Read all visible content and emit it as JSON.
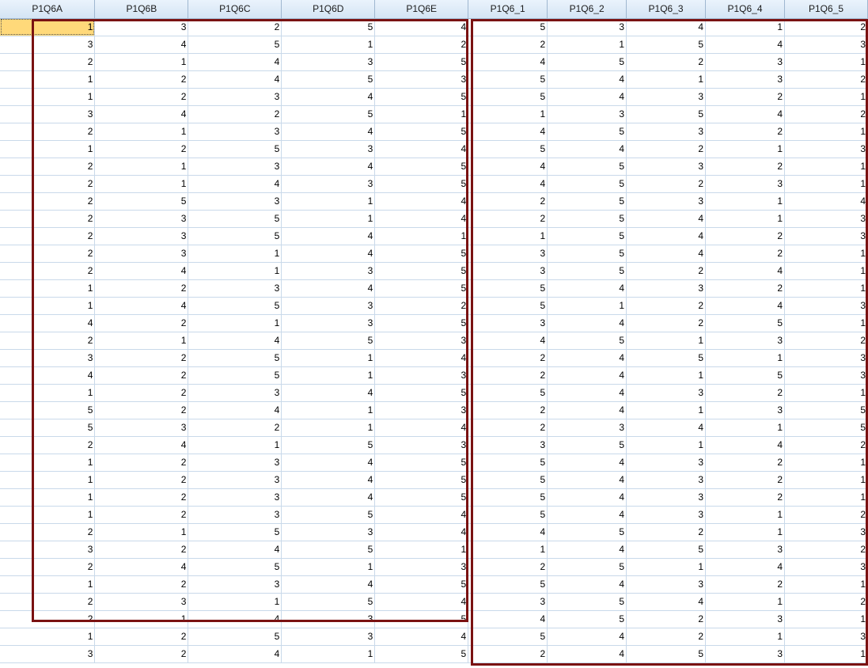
{
  "columns": [
    "P1Q6A",
    "P1Q6B",
    "P1Q6C",
    "P1Q6D",
    "P1Q6E",
    "P1Q6_1",
    "P1Q6_2",
    "P1Q6_3",
    "P1Q6_4",
    "P1Q6_5"
  ],
  "rows": [
    [
      "1",
      "3",
      "2",
      "5",
      "4",
      "5",
      "3",
      "4",
      "1",
      "2"
    ],
    [
      "3",
      "4",
      "5",
      "1",
      "2",
      "2",
      "1",
      "5",
      "4",
      "3"
    ],
    [
      "2",
      "1",
      "4",
      "3",
      "5",
      "4",
      "5",
      "2",
      "3",
      "1"
    ],
    [
      "1",
      "2",
      "4",
      "5",
      "3",
      "5",
      "4",
      "1",
      "3",
      "2"
    ],
    [
      "1",
      "2",
      "3",
      "4",
      "5",
      "5",
      "4",
      "3",
      "2",
      "1"
    ],
    [
      "3",
      "4",
      "2",
      "5",
      "1",
      "1",
      "3",
      "5",
      "4",
      "2"
    ],
    [
      "2",
      "1",
      "3",
      "4",
      "5",
      "4",
      "5",
      "3",
      "2",
      "1"
    ],
    [
      "1",
      "2",
      "5",
      "3",
      "4",
      "5",
      "4",
      "2",
      "1",
      "3"
    ],
    [
      "2",
      "1",
      "3",
      "4",
      "5",
      "4",
      "5",
      "3",
      "2",
      "1"
    ],
    [
      "2",
      "1",
      "4",
      "3",
      "5",
      "4",
      "5",
      "2",
      "3",
      "1"
    ],
    [
      "2",
      "5",
      "3",
      "1",
      "4",
      "2",
      "5",
      "3",
      "1",
      "4"
    ],
    [
      "2",
      "3",
      "5",
      "1",
      "4",
      "2",
      "5",
      "4",
      "1",
      "3"
    ],
    [
      "2",
      "3",
      "5",
      "4",
      "1",
      "1",
      "5",
      "4",
      "2",
      "3"
    ],
    [
      "2",
      "3",
      "1",
      "4",
      "5",
      "3",
      "5",
      "4",
      "2",
      "1"
    ],
    [
      "2",
      "4",
      "1",
      "3",
      "5",
      "3",
      "5",
      "2",
      "4",
      "1"
    ],
    [
      "1",
      "2",
      "3",
      "4",
      "5",
      "5",
      "4",
      "3",
      "2",
      "1"
    ],
    [
      "1",
      "4",
      "5",
      "3",
      "2",
      "5",
      "1",
      "2",
      "4",
      "3"
    ],
    [
      "4",
      "2",
      "1",
      "3",
      "5",
      "3",
      "4",
      "2",
      "5",
      "1"
    ],
    [
      "2",
      "1",
      "4",
      "5",
      "3",
      "4",
      "5",
      "1",
      "3",
      "2"
    ],
    [
      "3",
      "2",
      "5",
      "1",
      "4",
      "2",
      "4",
      "5",
      "1",
      "3"
    ],
    [
      "4",
      "2",
      "5",
      "1",
      "3",
      "2",
      "4",
      "1",
      "5",
      "3"
    ],
    [
      "1",
      "2",
      "3",
      "4",
      "5",
      "5",
      "4",
      "3",
      "2",
      "1"
    ],
    [
      "5",
      "2",
      "4",
      "1",
      "3",
      "2",
      "4",
      "1",
      "3",
      "5"
    ],
    [
      "5",
      "3",
      "2",
      "1",
      "4",
      "2",
      "3",
      "4",
      "1",
      "5"
    ],
    [
      "2",
      "4",
      "1",
      "5",
      "3",
      "3",
      "5",
      "1",
      "4",
      "2"
    ],
    [
      "1",
      "2",
      "3",
      "4",
      "5",
      "5",
      "4",
      "3",
      "2",
      "1"
    ],
    [
      "1",
      "2",
      "3",
      "4",
      "5",
      "5",
      "4",
      "3",
      "2",
      "1"
    ],
    [
      "1",
      "2",
      "3",
      "4",
      "5",
      "5",
      "4",
      "3",
      "2",
      "1"
    ],
    [
      "1",
      "2",
      "3",
      "5",
      "4",
      "5",
      "4",
      "3",
      "1",
      "2"
    ],
    [
      "2",
      "1",
      "5",
      "3",
      "4",
      "4",
      "5",
      "2",
      "1",
      "3"
    ],
    [
      "3",
      "2",
      "4",
      "5",
      "1",
      "1",
      "4",
      "5",
      "3",
      "2"
    ],
    [
      "2",
      "4",
      "5",
      "1",
      "3",
      "2",
      "5",
      "1",
      "4",
      "3"
    ],
    [
      "1",
      "2",
      "3",
      "4",
      "5",
      "5",
      "4",
      "3",
      "2",
      "1"
    ],
    [
      "2",
      "3",
      "1",
      "5",
      "4",
      "3",
      "5",
      "4",
      "1",
      "2"
    ],
    [
      "2",
      "1",
      "4",
      "3",
      "5",
      "4",
      "5",
      "2",
      "3",
      "1"
    ],
    [
      "1",
      "2",
      "5",
      "3",
      "4",
      "5",
      "4",
      "2",
      "1",
      "3"
    ],
    [
      "3",
      "2",
      "4",
      "1",
      "5",
      "2",
      "4",
      "5",
      "3",
      "1"
    ]
  ],
  "highlight_color": "#7a1212",
  "active_cell_color": "#ffd97a"
}
